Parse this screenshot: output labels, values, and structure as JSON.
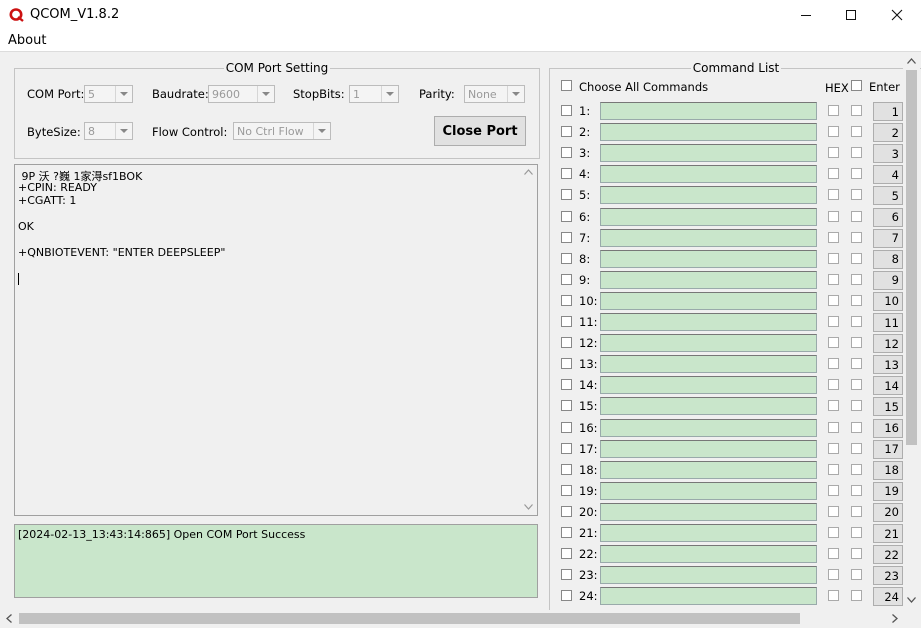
{
  "window": {
    "title": "QCOM_V1.8.2"
  },
  "menu": {
    "about": "About"
  },
  "com_settings": {
    "group_title": "COM Port Setting",
    "com_port_label": "COM Port:",
    "com_port_value": "5",
    "baudrate_label": "Baudrate:",
    "baudrate_value": "9600",
    "stopbits_label": "StopBits:",
    "stopbits_value": "1",
    "parity_label": "Parity:",
    "parity_value": "None",
    "bytesize_label": "ByteSize:",
    "bytesize_value": "8",
    "flow_label": "Flow Control:",
    "flow_value": "No Ctrl Flow",
    "close_button": "Close Port"
  },
  "receive": {
    "lines": [
      " 9P 沃 ?巍 1家淂sf1BOK",
      "+CPIN: READY",
      "+CGATT: 1",
      "",
      "OK",
      "",
      "+QNBIOTEVENT: \"ENTER DEEPSLEEP\""
    ]
  },
  "log": {
    "text": "[2024-02-13_13:43:14:865] Open COM Port Success"
  },
  "command_list": {
    "group_title": "Command List",
    "choose_all": "Choose All Commands",
    "hex_label": "HEX",
    "enter_label": "Enter",
    "rows": [
      {
        "label": "1:",
        "button": "1"
      },
      {
        "label": "2:",
        "button": "2"
      },
      {
        "label": "3:",
        "button": "3"
      },
      {
        "label": "4:",
        "button": "4"
      },
      {
        "label": "5:",
        "button": "5"
      },
      {
        "label": "6:",
        "button": "6"
      },
      {
        "label": "7:",
        "button": "7"
      },
      {
        "label": "8:",
        "button": "8"
      },
      {
        "label": "9:",
        "button": "9"
      },
      {
        "label": "10:",
        "button": "10"
      },
      {
        "label": "11:",
        "button": "11"
      },
      {
        "label": "12:",
        "button": "12"
      },
      {
        "label": "13:",
        "button": "13"
      },
      {
        "label": "14:",
        "button": "14"
      },
      {
        "label": "15:",
        "button": "15"
      },
      {
        "label": "16:",
        "button": "16"
      },
      {
        "label": "17:",
        "button": "17"
      },
      {
        "label": "18:",
        "button": "18"
      },
      {
        "label": "19:",
        "button": "19"
      },
      {
        "label": "20:",
        "button": "20"
      },
      {
        "label": "21:",
        "button": "21"
      },
      {
        "label": "22:",
        "button": "22"
      },
      {
        "label": "23:",
        "button": "23"
      },
      {
        "label": "24:",
        "button": "24"
      }
    ]
  },
  "colors": {
    "field_green": "#c9e6cb",
    "window_bg": "#f0f0f0",
    "logo_red": "#cc1111"
  },
  "icons": {
    "logo": "qcom-logo-icon",
    "minimize": "minimize-icon",
    "maximize": "maximize-icon",
    "close": "close-icon"
  }
}
